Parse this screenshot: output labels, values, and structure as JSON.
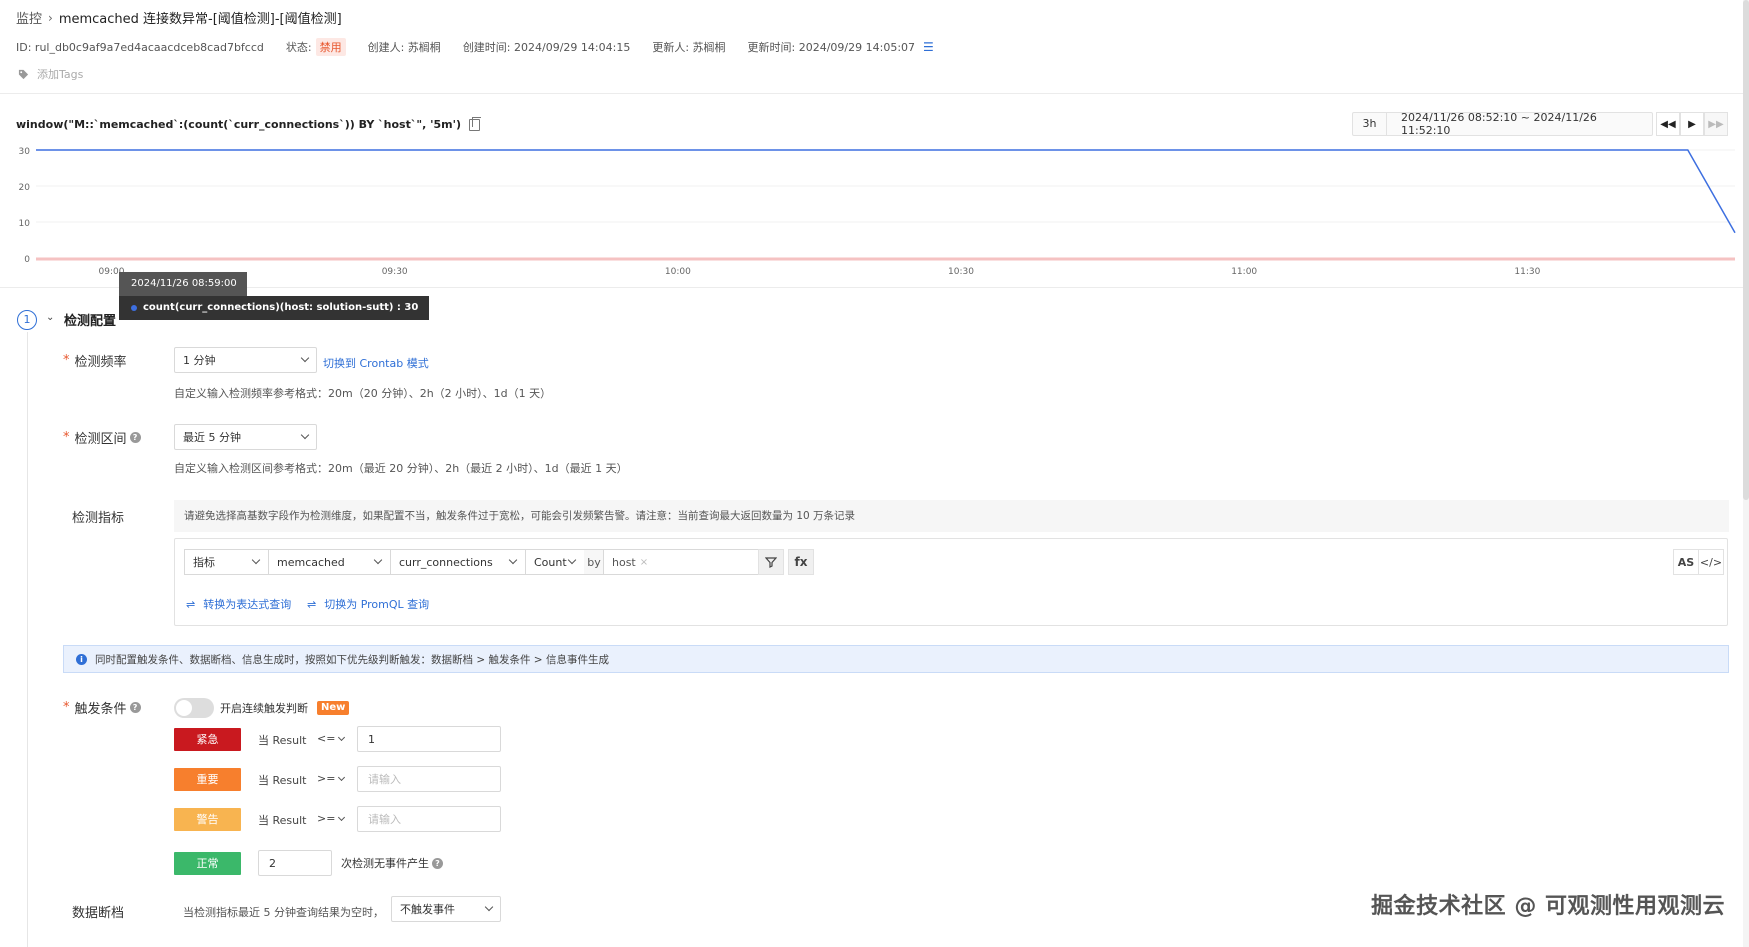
{
  "breadcrumb": {
    "root": "监控",
    "title": "memcached 连接数异常-[阈值检测]-[阈值检测]"
  },
  "meta": {
    "id": "ID: rul_db0c9af9a7ed4acaacdceb8cad7bfccd",
    "status_label": "状态:",
    "status_value": "禁用",
    "creator": "创建人: 苏榈桐",
    "created_at": "创建时间: 2024/09/29 14:04:15",
    "updater": "更新人: 苏榈桐",
    "updated_at": "更新时间: 2024/09/29 14:05:07"
  },
  "tags": {
    "add_label": "添加Tags"
  },
  "query": {
    "expression": "window(\"M::`memcached`:(count(`curr_connections`)) BY `host`\", '5m')"
  },
  "time_range": {
    "preset": "3h",
    "range": "2024/11/26 08:52:10 ~ 2024/11/26 11:52:10"
  },
  "tooltip": {
    "time": "2024/11/26 08:59:00",
    "series": "count(curr_connections)(host: solution-sutt) : 30"
  },
  "chart_data": {
    "type": "line",
    "x_ticks": [
      "09:00",
      "09:30",
      "10:00",
      "10:30",
      "11:00",
      "11:30"
    ],
    "y_ticks": [
      "0",
      "10",
      "20",
      "30"
    ],
    "ylim": [
      0,
      30
    ],
    "x": [
      "08:52",
      "08:55",
      "09:00",
      "09:30",
      "10:00",
      "10:30",
      "11:00",
      "11:30",
      "11:47",
      "11:52"
    ],
    "series": [
      {
        "name": "count(curr_connections)(host: solution-sutt)",
        "values": [
          30,
          30,
          30,
          30,
          30,
          30,
          30,
          30,
          30,
          7
        ]
      }
    ],
    "colors": {
      "line": "#3d6fe0",
      "threshold": "#f5c2c2"
    }
  },
  "section": {
    "step": "1",
    "title": "检测配置"
  },
  "frequency": {
    "label": "检测频率",
    "value": "1 分钟",
    "link": "切换到 Crontab 模式",
    "hint": "自定义输入检测频率参考格式：20m（20 分钟）、2h（2 小时）、1d（1 天）"
  },
  "interval": {
    "label": "检测区间",
    "value": "最近 5 分钟",
    "hint": "自定义输入检测区间参考格式：20m（最近 20 分钟）、2h（最近 2 小时）、1d（最近 1 天）"
  },
  "metric": {
    "label": "检测指标",
    "hint": "请避免选择高基数字段作为检测维度，如果配置不当，触发条件过于宽松，可能会引发频繁告警。请注意：当前查询最大返回数量为 10 万条记录",
    "type": "指标",
    "measurement": "memcached",
    "field": "curr_connections",
    "agg": "Count",
    "by": "by",
    "group": "host",
    "filter_icon": "filter-icon",
    "fx": "fx",
    "as": "AS",
    "code": "</>",
    "switch_expr": "转换为表达式查询",
    "switch_promql": "切换为 PromQL 查询"
  },
  "info": {
    "text": "同时配置触发条件、数据断档、信息生成时，按照如下优先级判断触发：数据断档 > 触发条件 > 信息事件生成"
  },
  "trigger": {
    "label": "触发条件",
    "toggle_label": "开启连续触发判断",
    "new_badge": "New",
    "levels": [
      {
        "name": "紧急",
        "color": "#c9191f",
        "cond": "当 Result",
        "op": "<=",
        "value": "1",
        "placeholder": ""
      },
      {
        "name": "重要",
        "color": "#f77f2d",
        "cond": "当 Result",
        "op": ">=",
        "value": "",
        "placeholder": "请输入"
      },
      {
        "name": "警告",
        "color": "#f8b450",
        "cond": "当 Result",
        "op": ">=",
        "value": "",
        "placeholder": "请输入"
      }
    ],
    "normal": {
      "name": "正常",
      "color": "#3bb86a",
      "value": "2",
      "suffix": "次检测无事件产生"
    }
  },
  "nodata": {
    "label": "数据断档",
    "hint": "当检测指标最近 5 分钟查询结果为空时，",
    "value": "不触发事件"
  },
  "watermark": "掘金技术社区 @ 可观测性用观测云"
}
